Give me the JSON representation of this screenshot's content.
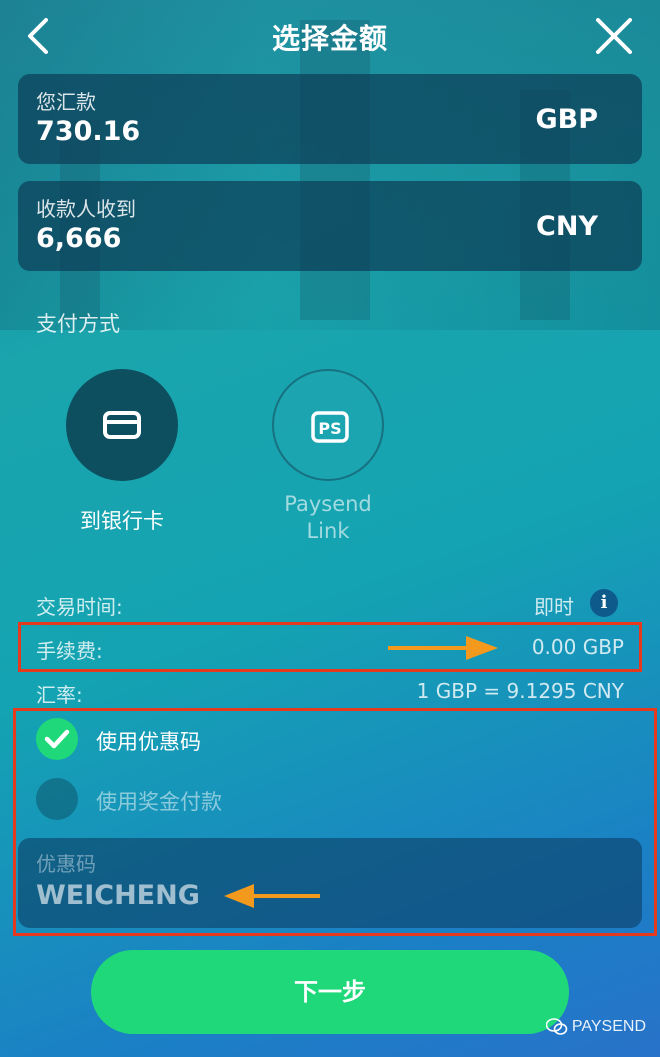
{
  "header": {
    "title": "选择金额"
  },
  "send": {
    "label": "您汇款",
    "amount": "730.16",
    "currency": "GBP"
  },
  "receive": {
    "label": "收款人收到",
    "amount": "6,666",
    "currency": "CNY"
  },
  "payment_methods": {
    "section_label": "支付方式",
    "items": [
      {
        "label": "到银行卡",
        "icon": "card-icon",
        "selected": true
      },
      {
        "label_line1": "Paysend",
        "label_line2": "Link",
        "icon": "paysend-link-icon",
        "selected": false
      }
    ]
  },
  "details": {
    "time_label": "交易时间:",
    "time_value": "即时",
    "fee_label": "手续费:",
    "fee_value": "0.00 GBP",
    "rate_label": "汇率:",
    "rate_value": "1 GBP = 9.1295 CNY"
  },
  "options": {
    "use_promo_label": "使用优惠码",
    "use_promo_checked": true,
    "use_bonus_label": "使用奖金付款",
    "use_bonus_checked": false
  },
  "promo": {
    "label": "优惠码",
    "value": "WEICHENG"
  },
  "next_button": {
    "label": "下一步"
  },
  "watermark": {
    "text": "PAYSEND"
  },
  "colors": {
    "accent_green": "#1fd87a",
    "highlight_red": "#e63a1e",
    "arrow_orange": "#f39a1e"
  }
}
